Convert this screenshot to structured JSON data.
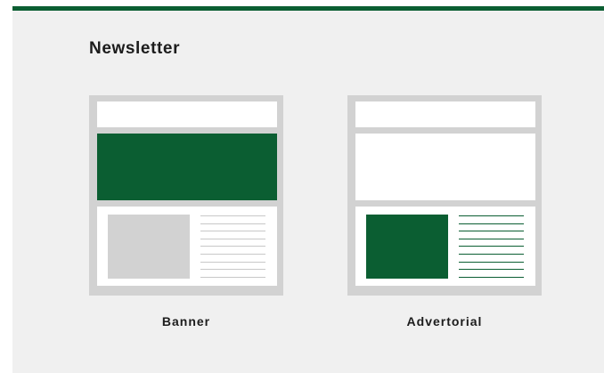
{
  "title": "Newsletter",
  "colors": {
    "accent": "#0b5e32",
    "panel_bg": "#f0f0f0",
    "frame": "#d2d2d2",
    "placeholder": "#d2d2d2",
    "muted_line": "#c8c8c8"
  },
  "options": [
    {
      "label": "Banner",
      "hero_fill": "accent",
      "thumb_fill": "placeholder",
      "lines_style": "muted"
    },
    {
      "label": "Advertorial",
      "hero_fill": "white",
      "thumb_fill": "accent",
      "lines_style": "accent"
    }
  ]
}
